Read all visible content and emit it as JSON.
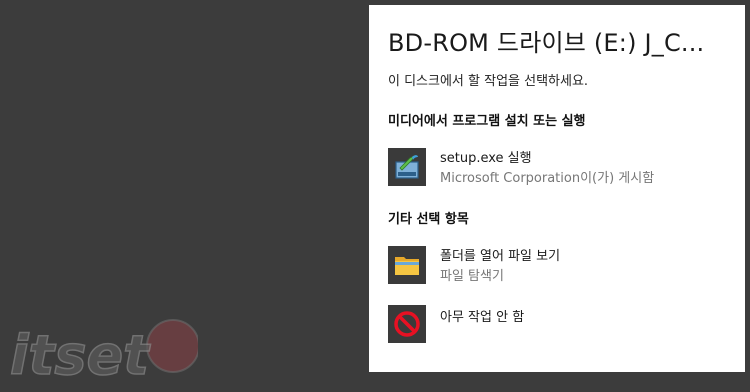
{
  "autoplay": {
    "title": "BD-ROM 드라이브 (E:) J_C...",
    "prompt": "이 디스크에서 할 작업을 선택하세요.",
    "sections": {
      "media": {
        "heading": "미디어에서 프로그램 설치 또는 실행",
        "options": [
          {
            "label": "setup.exe 실행",
            "sublabel": "Microsoft Corporation이(가) 게시함",
            "icon": "setup-installer-icon"
          }
        ]
      },
      "other": {
        "heading": "기타 선택 항목",
        "options": [
          {
            "label": "폴더를 열어 파일 보기",
            "sublabel": "파일 탐색기",
            "icon": "folder-icon"
          },
          {
            "label": "아무 작업 안 함",
            "icon": "no-action-icon"
          }
        ]
      }
    }
  },
  "watermark": {
    "text": "itset"
  },
  "colors": {
    "background": "#3c3c3c",
    "panel": "#ffffff",
    "icon_tile": "#3a3a3a",
    "no_action_red": "#e81123",
    "folder_yellow": "#f5c542"
  }
}
